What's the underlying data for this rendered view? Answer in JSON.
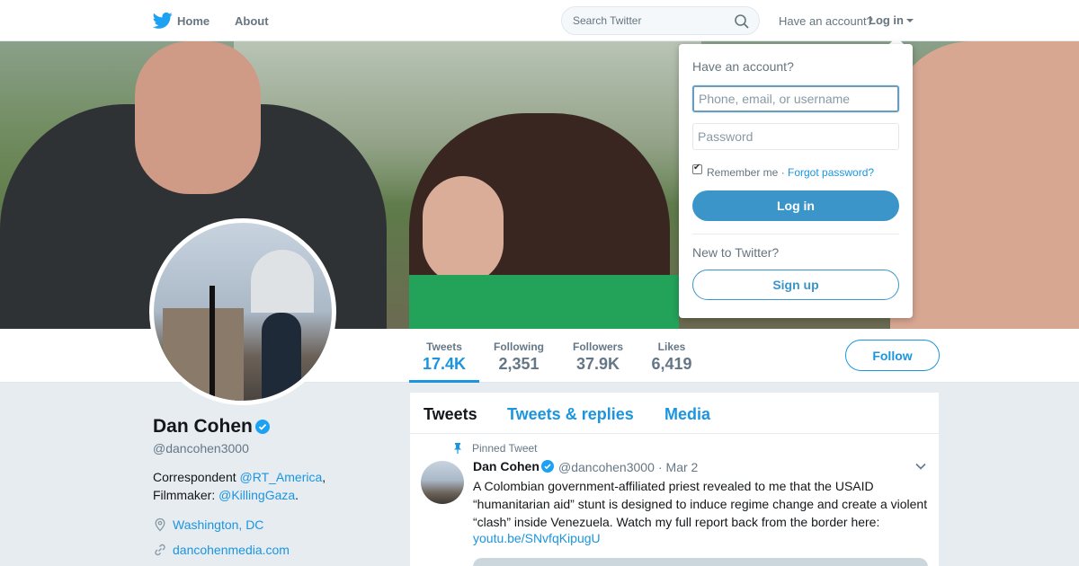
{
  "nav": {
    "home_label": "Home",
    "about_label": "About",
    "search_placeholder": "Search Twitter",
    "have_account": "Have an account?",
    "login_label": "Log in"
  },
  "profile": {
    "name": "Dan Cohen",
    "handle": "@dancohen3000",
    "bio_prefix": "Correspondent ",
    "bio_link1": "@RT_America",
    "bio_comma": ",",
    "bio_line2_prefix": "Filmmaker: ",
    "bio_link2": "@KillingGaza",
    "bio_period": ".",
    "location": "Washington, DC",
    "website": "dancohenmedia.com",
    "follow_label": "Follow"
  },
  "stats": [
    {
      "label": "Tweets",
      "value": "17.4K"
    },
    {
      "label": "Following",
      "value": "2,351"
    },
    {
      "label": "Followers",
      "value": "37.9K"
    },
    {
      "label": "Likes",
      "value": "6,419"
    }
  ],
  "tabs": [
    {
      "label": "Tweets"
    },
    {
      "label": "Tweets & replies"
    },
    {
      "label": "Media"
    }
  ],
  "tweet": {
    "pinned_label": "Pinned Tweet",
    "author": "Dan Cohen",
    "handle": "@dancohen3000",
    "date": "· Mar 2",
    "text": "A Colombian government-affiliated priest revealed to me that the USAID “humanitarian aid” stunt is designed to induce regime change and create a violent “clash” inside Venezuela. Watch my full report back from the border here:",
    "link": "youtu.be/SNvfqKipugU"
  },
  "login_dropdown": {
    "title": "Have an account?",
    "username_placeholder": "Phone, email, or username",
    "password_placeholder": "Password",
    "remember_label": "Remember me ·",
    "forgot_label": "Forgot password?",
    "remember_checked": true,
    "login_button": "Log in",
    "new_label": "New to Twitter?",
    "signup_button": "Sign up"
  },
  "colors": {
    "accent": "#1b95e0",
    "login_button": "#3b95c9",
    "background": "#e6ecf0"
  }
}
